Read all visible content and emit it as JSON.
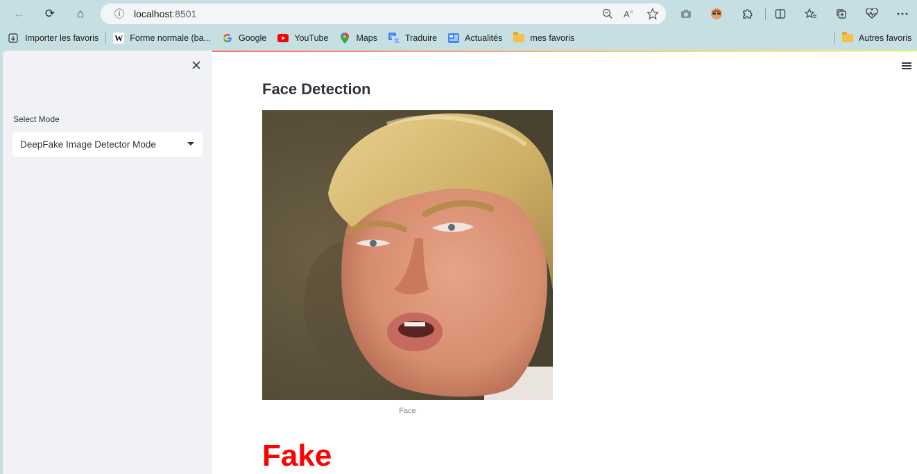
{
  "browser": {
    "url_host": "localhost",
    "url_port": ":8501",
    "nav": {
      "back_icon": "←",
      "reload_icon": "⟳",
      "home_icon": "⌂",
      "info_icon": "ⓘ"
    },
    "addr_icons": [
      "zoom-out-icon",
      "read-aloud-icon",
      "star-icon"
    ],
    "extension_icons": [
      "camera-icon",
      "avatar-extension-icon",
      "puzzle-icon",
      "split-screen-icon",
      "favorites-icon",
      "collections-icon",
      "heart-pulse-icon",
      "more-icon"
    ]
  },
  "bookmarks": {
    "items": [
      {
        "label": "Importer les favoris",
        "icon": "import-icon"
      },
      {
        "label": "Forme normale (ba...",
        "icon": "wikipedia-icon"
      },
      {
        "label": "Google",
        "icon": "google-icon"
      },
      {
        "label": "YouTube",
        "icon": "youtube-icon"
      },
      {
        "label": "Maps",
        "icon": "maps-icon"
      },
      {
        "label": "Traduire",
        "icon": "translate-icon"
      },
      {
        "label": "Actualités",
        "icon": "news-icon"
      },
      {
        "label": "mes favoris",
        "icon": "folder-icon"
      }
    ],
    "other": "Autres favoris"
  },
  "sidebar": {
    "select_label": "Select Mode",
    "select_value": "DeepFake Image Detector Mode"
  },
  "main": {
    "title": "Face Detection",
    "image_caption": "Face",
    "verdict": "Fake",
    "verdict_color": "#ff0000"
  },
  "colors": {
    "accent_red": "#ff4b4b",
    "sidebar_bg": "#f0f2f6",
    "text": "#31333f"
  }
}
